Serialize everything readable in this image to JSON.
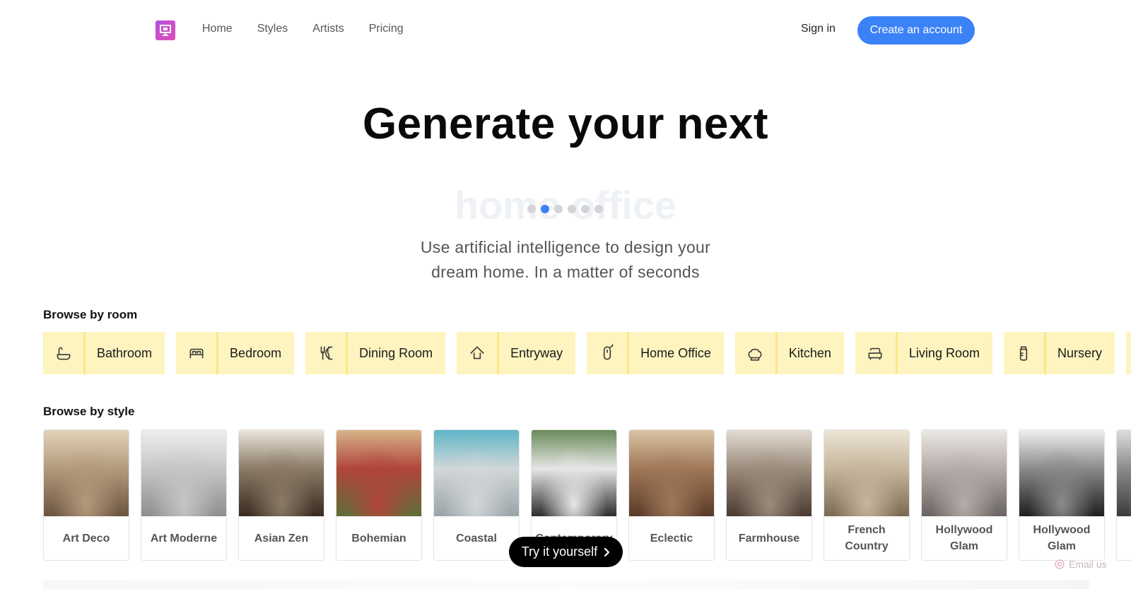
{
  "nav": {
    "links": [
      "Home",
      "Styles",
      "Artists",
      "Pricing"
    ],
    "sign_in": "Sign in",
    "cta": "Create an account"
  },
  "hero": {
    "title": "Generate your next",
    "rotating_word": "home office",
    "carousel": {
      "count": 6,
      "active_index": 1
    },
    "subtitle_line1": "Use artificial intelligence to design your",
    "subtitle_line2": "dream home. In a matter of seconds"
  },
  "rooms": {
    "heading": "Browse by room",
    "items": [
      {
        "label": "Bathroom",
        "icon": "bathtub-icon"
      },
      {
        "label": "Bedroom",
        "icon": "bed-icon"
      },
      {
        "label": "Dining Room",
        "icon": "utensils-icon"
      },
      {
        "label": "Entryway",
        "icon": "house-arrow-icon"
      },
      {
        "label": "Home Office",
        "icon": "mouse-icon"
      },
      {
        "label": "Kitchen",
        "icon": "chef-hat-icon"
      },
      {
        "label": "Living Room",
        "icon": "armchair-icon"
      },
      {
        "label": "Nursery",
        "icon": "baby-bottle-icon"
      },
      {
        "label": "",
        "icon": ""
      }
    ]
  },
  "styles": {
    "heading": "Browse by style",
    "items": [
      {
        "label": "Art Deco",
        "colors": [
          "#6b5440",
          "#b39a7c",
          "#e2d2b8"
        ]
      },
      {
        "label": "Art Moderne",
        "colors": [
          "#8d8d8f",
          "#c8c6c4",
          "#eeeeec"
        ]
      },
      {
        "label": "Asian Zen",
        "colors": [
          "#3a2a20",
          "#8a7a66",
          "#ece6dc"
        ]
      },
      {
        "label": "Bohemian",
        "colors": [
          "#5e6e3a",
          "#b0453a",
          "#d8b48a"
        ]
      },
      {
        "label": "Coastal",
        "colors": [
          "#9aa4a8",
          "#d2d6d8",
          "#5fb6c8"
        ]
      },
      {
        "label": "Contemporary",
        "colors": [
          "#2c2c2c",
          "#e6e6e6",
          "#6a8a5a"
        ]
      },
      {
        "label": "Eclectic",
        "colors": [
          "#5a3a28",
          "#a07858",
          "#d9c4a4"
        ]
      },
      {
        "label": "Farmhouse",
        "colors": [
          "#4a3a30",
          "#9c8c7c",
          "#e3dcd2"
        ]
      },
      {
        "label": "French Country",
        "colors": [
          "#7a6a52",
          "#c6b69c",
          "#ece4d4"
        ]
      },
      {
        "label": "Hollywood Glam",
        "colors": [
          "#6a6462",
          "#b4aca8",
          "#ece8e4"
        ]
      },
      {
        "label": "Hollywood Glam",
        "colors": [
          "#1e1e1e",
          "#8a8a8a",
          "#f0f0ee"
        ]
      },
      {
        "label": "",
        "colors": [
          "#3a3a3a",
          "#8a8a8a",
          "#dedede"
        ]
      }
    ]
  },
  "floating": {
    "try_button": "Try it yourself",
    "email": "Email us"
  },
  "colors": {
    "accent": "#3b82f6",
    "room_bg": "#fef4bf",
    "room_divider": "#fbe68a"
  }
}
